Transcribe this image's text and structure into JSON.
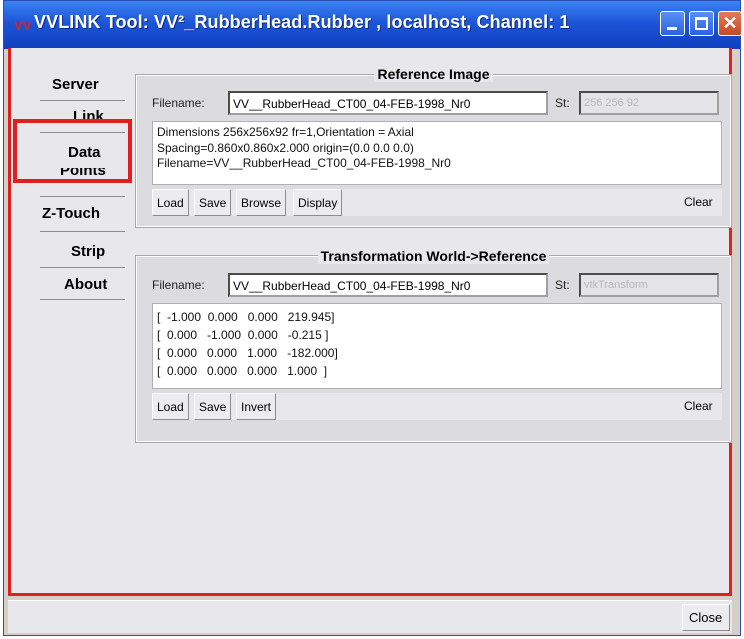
{
  "window": {
    "title": "VVLINK Tool: VV²_RubberHead.Rubber , localhost, Channel: 1",
    "app_icon": "VV"
  },
  "nav": {
    "items": [
      "Server",
      "Link",
      "Data",
      "Points",
      "Z-Touch",
      "Strip",
      "About"
    ]
  },
  "reference": {
    "title": "Reference Image",
    "filename_label": "Filename:",
    "filename_value": "VV__RubberHead_CT00_04-FEB-1998_Nr0",
    "st_label": "St:",
    "st_value": "256 256 92",
    "info_lines": [
      "Dimensions 256x256x92 fr=1,Orientation = Axial",
      "Spacing=0.860x0.860x2.000 origin=(0.0 0.0 0.0)",
      "Filename=VV__RubberHead_CT00_04-FEB-1998_Nr0"
    ],
    "buttons": [
      "Load",
      "Save",
      "Browse",
      "Display"
    ],
    "clear_label": "Clear"
  },
  "transform": {
    "title": "Transformation World->Reference",
    "filename_label": "Filename:",
    "filename_value": "VV__RubberHead_CT00_04-FEB-1998_Nr0",
    "st_label": "St:",
    "st_value": "vtkTransform",
    "matrix_lines": [
      "[  -1.000  0.000   0.000   219.945]",
      "[  0.000   -1.000  0.000   -0.215 ]",
      "[  0.000   0.000   1.000   -182.000]",
      "[  0.000   0.000   0.000   1.000  ]"
    ],
    "buttons": [
      "Load",
      "Save",
      "Invert"
    ],
    "clear_label": "Clear"
  },
  "footer": {
    "close_label": "Close"
  }
}
